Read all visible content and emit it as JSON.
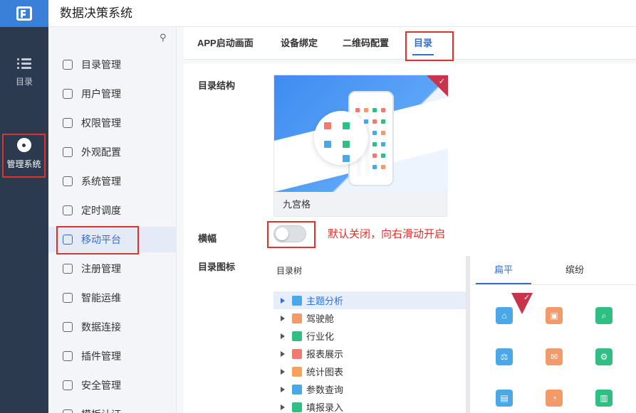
{
  "app": {
    "title": "数据决策系统"
  },
  "rail": {
    "catalog_label": "目录",
    "manage_label": "管理系统"
  },
  "sidebar": {
    "items": [
      {
        "label": "目录管理",
        "icon": "list-icon"
      },
      {
        "label": "用户管理",
        "icon": "user-icon"
      },
      {
        "label": "权限管理",
        "icon": "lock-icon"
      },
      {
        "label": "外观配置",
        "icon": "paint-roller-icon"
      },
      {
        "label": "系统管理",
        "icon": "gear-icon"
      },
      {
        "label": "定时调度",
        "icon": "timer-icon"
      },
      {
        "label": "移动平台",
        "icon": "mobile-icon",
        "active": true
      },
      {
        "label": "注册管理",
        "icon": "register-icon"
      },
      {
        "label": "智能运维",
        "icon": "network-icon"
      },
      {
        "label": "数据连接",
        "icon": "link-icon"
      },
      {
        "label": "插件管理",
        "icon": "puzzle-icon"
      },
      {
        "label": "安全管理",
        "icon": "shield-icon"
      },
      {
        "label": "模板认证",
        "icon": "certificate-icon"
      }
    ]
  },
  "tabs": [
    {
      "label": "APP启动画面"
    },
    {
      "label": "设备绑定"
    },
    {
      "label": "二维码配置"
    },
    {
      "label": "目录",
      "active": true
    }
  ],
  "form": {
    "structure_label": "目录结构",
    "structure_option": "九宫格",
    "landscape_label": "横幅",
    "landscape_on": false,
    "landscape_hint": "默认关闭，向右滑动开启",
    "icon_label": "目录图标"
  },
  "tree": {
    "header": "目录树",
    "items": [
      {
        "label": "主题分析",
        "color": "#4aa8e8",
        "selected": true
      },
      {
        "label": "驾驶舱",
        "color": "#f39a6b"
      },
      {
        "label": "行业化",
        "color": "#2fbf85"
      },
      {
        "label": "报表展示",
        "color": "#f07a6e"
      },
      {
        "label": "统计图表",
        "color": "#f5a35c"
      },
      {
        "label": "参数查询",
        "color": "#4aa8e8"
      },
      {
        "label": "填报录入",
        "color": "#2fbf85"
      }
    ]
  },
  "icon_styles": {
    "tabs": [
      {
        "label": "扁平",
        "active": true
      },
      {
        "label": "缤纷"
      }
    ],
    "grid": [
      {
        "name": "home-icon",
        "color": "#4aa8e8"
      },
      {
        "name": "presentation-icon",
        "color": "#f39a6b"
      },
      {
        "name": "search-icon",
        "color": "#2fbf85"
      },
      {
        "name": "balance-icon",
        "color": "#4aa8e8"
      },
      {
        "name": "briefcase-icon",
        "color": "#f39a6b"
      },
      {
        "name": "gear-search-icon",
        "color": "#2fbf85"
      },
      {
        "name": "document-icon",
        "color": "#4aa8e8"
      },
      {
        "name": "chart-circle-icon",
        "color": "#f39a6b"
      },
      {
        "name": "file-icon",
        "color": "#2fbf85"
      }
    ]
  }
}
